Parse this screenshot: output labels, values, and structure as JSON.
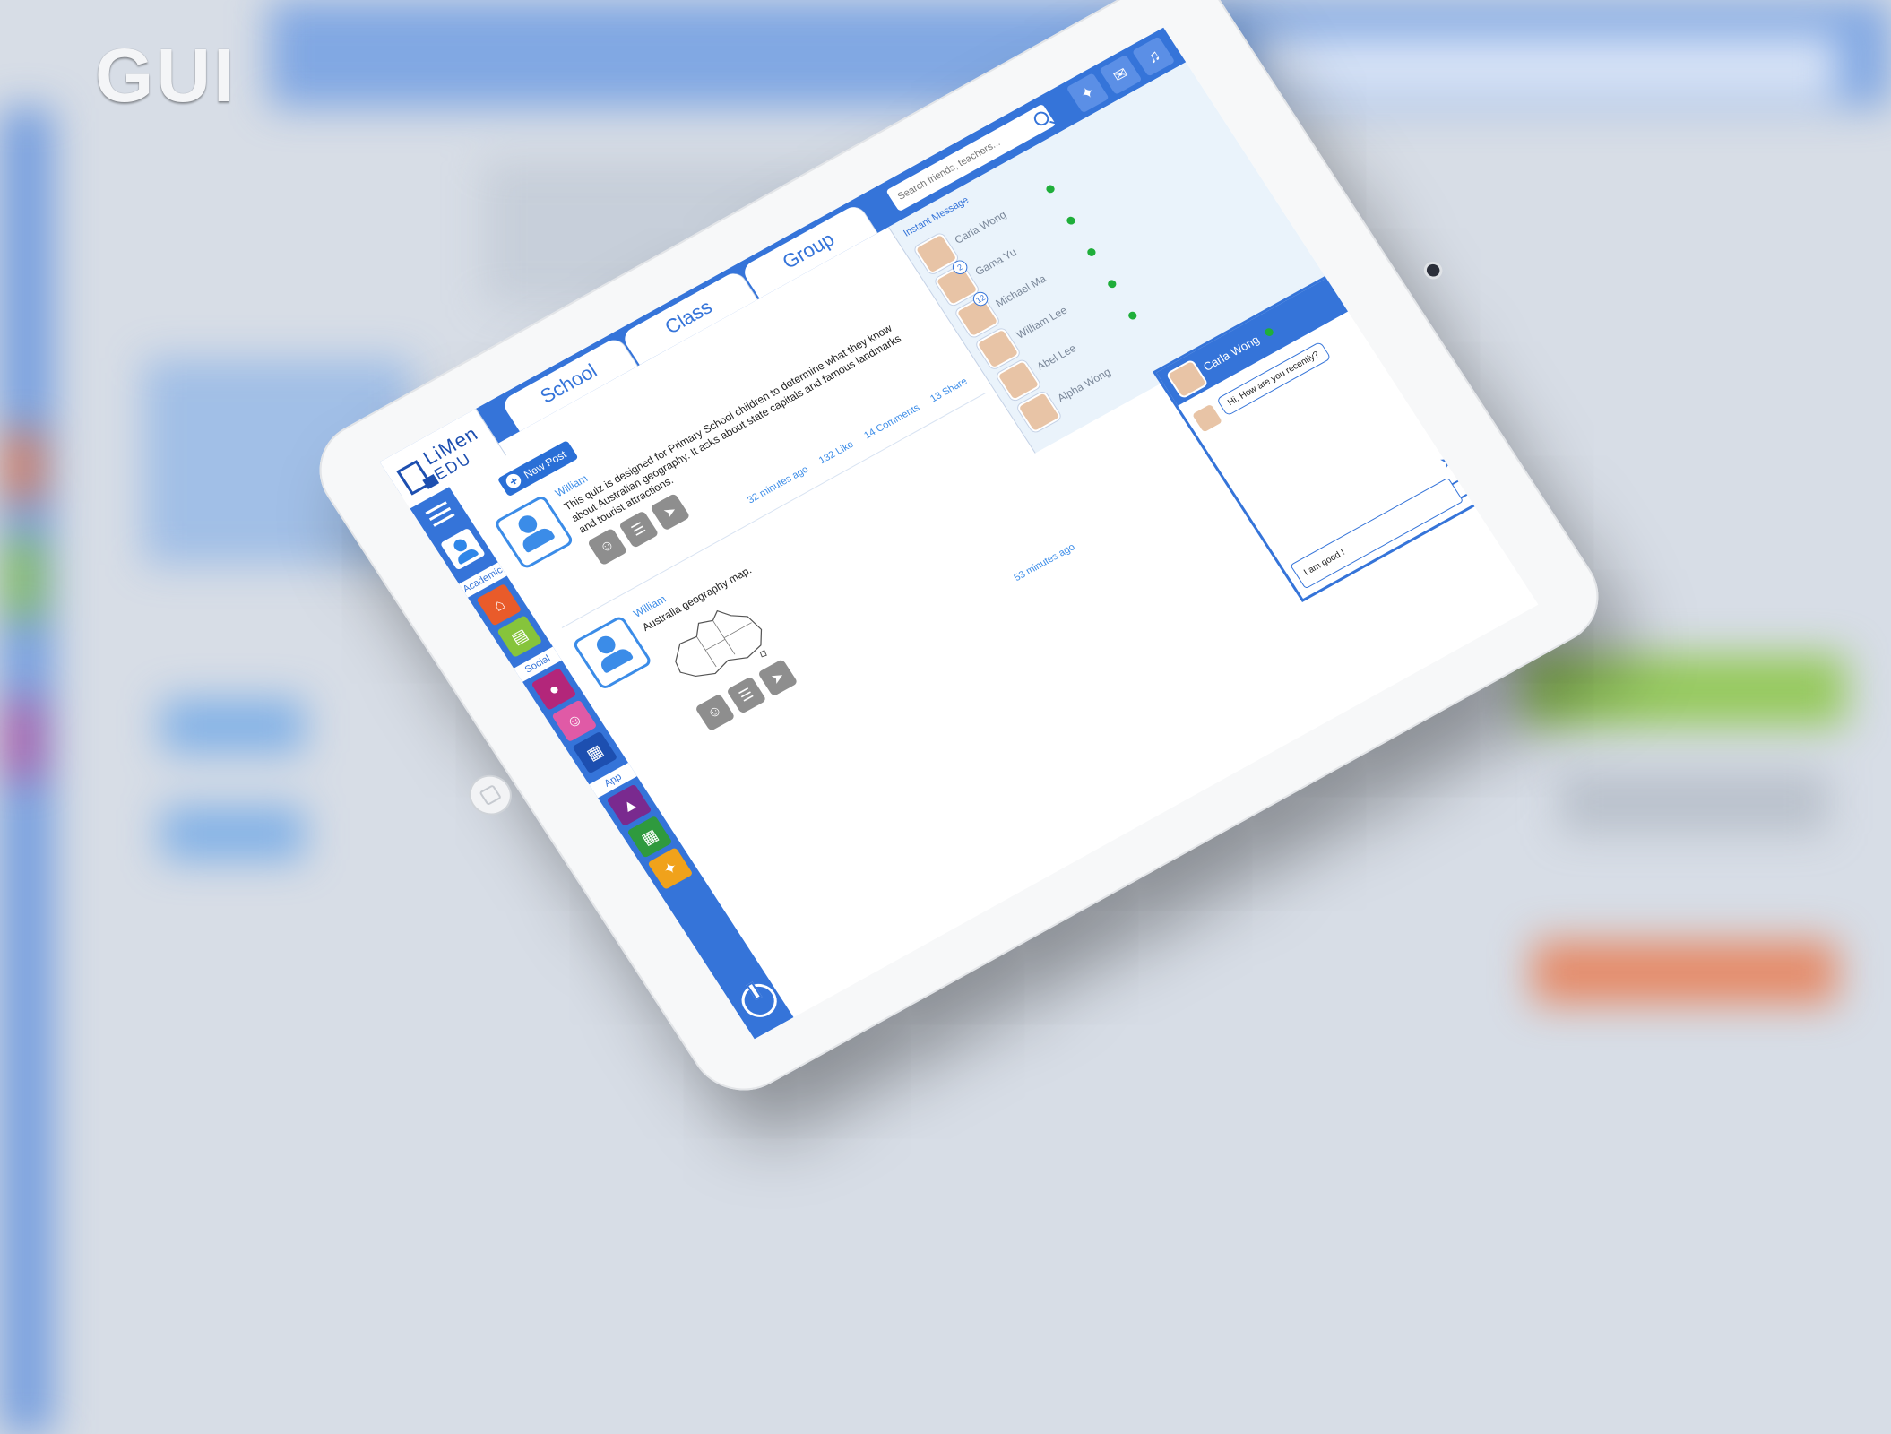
{
  "overlay_label": "GUI",
  "colors": {
    "primary": "#3574d9",
    "online": "#1fae3a",
    "link": "#3b8ce8"
  },
  "app": {
    "logo_name": "LiMen",
    "logo_sub": "EDU",
    "tabs": [
      {
        "label": "School"
      },
      {
        "label": "Class"
      },
      {
        "label": "Group"
      }
    ],
    "search_placeholder": "Search friends, teachers...",
    "top_icons": [
      "bird-icon",
      "mail-icon",
      "bell-icon"
    ]
  },
  "sidebar": {
    "sections": {
      "academic": "Academic",
      "social": "Social",
      "app": "App"
    },
    "academic_icons": [
      "school-icon",
      "book-icon"
    ],
    "social_icons": [
      "users-icon",
      "group-icon",
      "calendar-icon"
    ],
    "app_icons": [
      "library-icon",
      "apps-icon",
      "network-icon"
    ]
  },
  "feed": {
    "new_post": "New Post",
    "posts": [
      {
        "author": "William",
        "text": "This quiz is designed for Primary School children to determine what they know about Australian geography. It asks about state capitals and famous landmarks and tourist attractions.",
        "time": "32 minutes ago",
        "likes": "132 Like",
        "comments": "14 Comments",
        "shares": "13 Share"
      },
      {
        "author": "William",
        "text": "Australia geography map.",
        "time": "53 minutes ago",
        "likes": "",
        "comments": "",
        "shares": ""
      }
    ]
  },
  "instant_message": {
    "title": "Instant Message",
    "contacts": [
      {
        "name": "Carla Wong",
        "online": true,
        "badge": ""
      },
      {
        "name": "Gama Yu",
        "online": true,
        "badge": "2"
      },
      {
        "name": "Michael Ma",
        "online": true,
        "badge": "12"
      },
      {
        "name": "William Lee",
        "online": true,
        "badge": ""
      },
      {
        "name": "Abel Lee",
        "online": true,
        "badge": ""
      },
      {
        "name": "Alpha Wong",
        "online": false,
        "badge": ""
      }
    ]
  },
  "chat": {
    "contact": "Carla Wong",
    "incoming": "Hi, How are you recently?",
    "input_value": "I am good !"
  }
}
